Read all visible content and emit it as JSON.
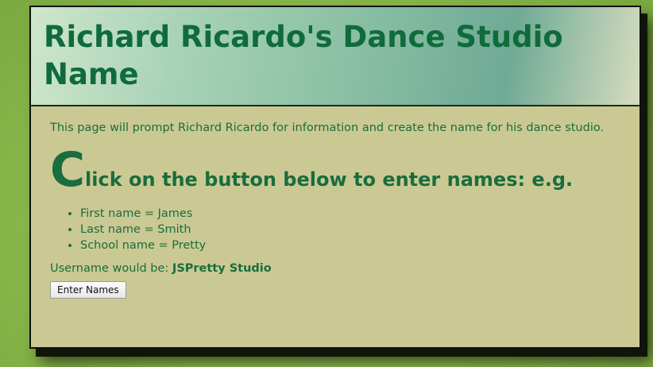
{
  "header": {
    "title": "Richard Ricardo's Dance Studio Name"
  },
  "content": {
    "intro": "This page will prompt Richard Ricardo for information and create the name for his dance studio.",
    "subheading_dropcap": "C",
    "subheading_rest": "lick on the button below to enter names: e.g.",
    "examples": [
      "First name = James",
      "Last name = Smith",
      "School name = Pretty"
    ],
    "username_label": "Username would be: ",
    "username_value": "JSPretty Studio",
    "button_label": "Enter Names"
  }
}
